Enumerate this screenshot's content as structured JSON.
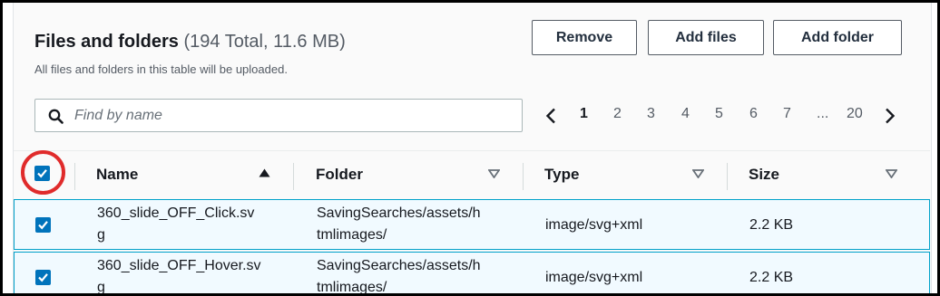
{
  "header": {
    "title": "Files and folders",
    "counter": "(194 Total, 11.6 MB)",
    "description": "All files and folders in this table will be uploaded."
  },
  "actions": {
    "remove_label": "Remove",
    "add_files_label": "Add files",
    "add_folder_label": "Add folder"
  },
  "search": {
    "placeholder": "Find by name",
    "icon": "search-icon"
  },
  "pagination": {
    "current_page": "1",
    "pages": [
      "1",
      "2",
      "3",
      "4",
      "5",
      "6",
      "7",
      "...",
      "20"
    ],
    "prev_icon": "chevron-left-icon",
    "next_icon": "chevron-right-icon"
  },
  "table": {
    "columns": [
      {
        "label": "Name",
        "sort": "ascending"
      },
      {
        "label": "Folder",
        "sort": "none"
      },
      {
        "label": "Type",
        "sort": "none"
      },
      {
        "label": "Size",
        "sort": "none"
      }
    ],
    "select_all_checked": true,
    "rows": [
      {
        "checked": true,
        "name_line1": "360_slide_OFF_Click.sv",
        "name_line2": "g",
        "folder_line1": "SavingSearches/assets/h",
        "folder_line2": "tmlimages/",
        "type": "image/svg+xml",
        "size": "2.2 KB"
      },
      {
        "checked": true,
        "name_line1": "360_slide_OFF_Hover.sv",
        "name_line2": "g",
        "folder_line1": "SavingSearches/assets/h",
        "folder_line2": "tmlimages/",
        "type": "image/svg+xml",
        "size": "2.2 KB"
      }
    ]
  },
  "colors": {
    "accent": "#0073bb",
    "selected_row_bg": "#f1faff",
    "selected_row_border": "#00a1c9",
    "highlight_ring": "#e02b2b"
  }
}
